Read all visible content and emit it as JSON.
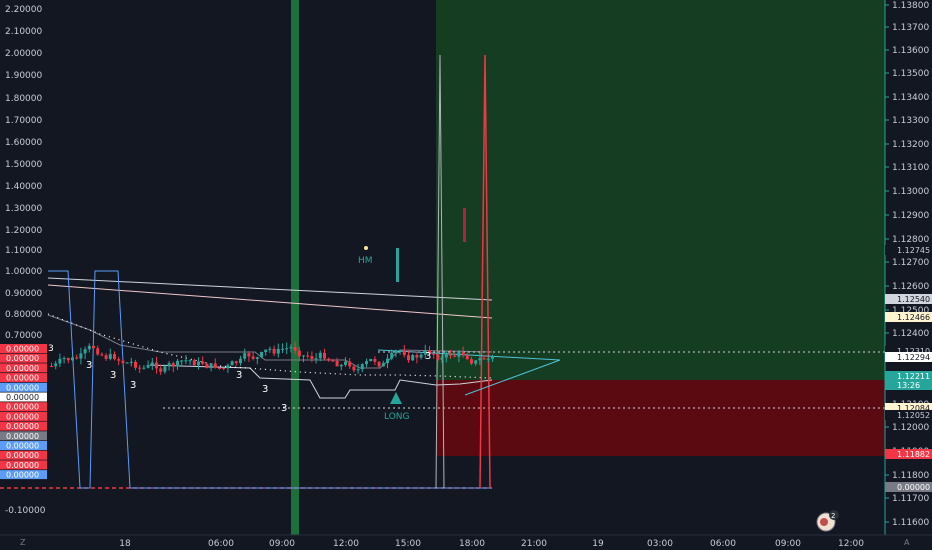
{
  "left_axis": {
    "ticks": [
      "2.20000",
      "2.10000",
      "2.00000",
      "1.90000",
      "1.80000",
      "1.70000",
      "1.60000",
      "1.50000",
      "1.40000",
      "1.30000",
      "1.20000",
      "1.10000",
      "1.00000",
      "0.90000",
      "0.80000",
      "0.70000",
      "0.00000",
      "-0.10000"
    ],
    "badges": [
      {
        "label": "0.00000",
        "color": "#f23645"
      },
      {
        "label": "0.00000",
        "color": "#f23645"
      },
      {
        "label": "0.00000",
        "color": "#f23645"
      },
      {
        "label": "0.00000",
        "color": "#f23645"
      },
      {
        "label": "0.00000",
        "color": "#5b9cf6"
      },
      {
        "label": "0.00000",
        "color": "#ffffff"
      },
      {
        "label": "0.00000",
        "color": "#f23645"
      },
      {
        "label": "0.00000",
        "color": "#f23645"
      },
      {
        "label": "0.00000",
        "color": "#f23645"
      },
      {
        "label": "0.00000",
        "color": "#787b86"
      },
      {
        "label": "0.00000",
        "color": "#5b9cf6"
      },
      {
        "label": "0.00000",
        "color": "#f23645"
      },
      {
        "label": "0.00000",
        "color": "#f23645"
      },
      {
        "label": "0.00000",
        "color": "#5b9cf6"
      }
    ],
    "badge_overflow": "3"
  },
  "right_axis": {
    "ticks": [
      "1.13800",
      "1.13700",
      "1.13600",
      "1.13500",
      "1.13400",
      "1.13300",
      "1.13200",
      "1.13100",
      "1.13000",
      "1.12900",
      "1.12800",
      "1.12700",
      "1.12600",
      "1.12500",
      "1.12400",
      "1.12300",
      "1.12100",
      "1.12000",
      "1.11900",
      "1.11800",
      "1.11700",
      "1.11600"
    ],
    "labels": [
      {
        "text": "1.12745",
        "bg": "#131722",
        "fg": "#c9ccd4"
      },
      {
        "text": "1.12540",
        "bg": "#d1d4dc",
        "fg": "#131722"
      },
      {
        "text": "1.12466",
        "bg": "#fff3d0",
        "fg": "#131722"
      },
      {
        "text": "1.12310",
        "bg": "#131722",
        "fg": "#c9ccd4"
      },
      {
        "text": "1.12294",
        "bg": "#ffffff",
        "fg": "#131722"
      },
      {
        "text": "1.12211",
        "bg": "#26a69a",
        "fg": "#ffffff"
      },
      {
        "text": "13:26",
        "bg": "#26a69a",
        "fg": "#ffffff"
      },
      {
        "text": "1.12084",
        "bg": "#fff3d0",
        "fg": "#131722"
      },
      {
        "text": "1.12052",
        "bg": "#131722",
        "fg": "#c9ccd4"
      },
      {
        "text": "1.11882",
        "bg": "#f23645",
        "fg": "#ffffff"
      },
      {
        "text": "0.00000",
        "bg": "#787b86",
        "fg": "#ffffff"
      }
    ]
  },
  "time_axis": {
    "ticks": [
      "18",
      "06:00",
      "09:00",
      "12:00",
      "15:00",
      "18:00",
      "21:00",
      "19",
      "03:00",
      "06:00",
      "09:00",
      "12:00"
    ],
    "left_button": "Z",
    "right_button": "A"
  },
  "annotations": {
    "hm_label": "HM",
    "long_label": "LONG",
    "counts": [
      "3",
      "3",
      "3",
      "3",
      "3",
      "3",
      "3"
    ]
  },
  "alert_badge": {
    "count": "2"
  },
  "colors": {
    "background": "#131722",
    "bull": "#26a69a",
    "bear": "#f23645",
    "profit_zone": "#143d22",
    "loss_zone": "#5a0a10",
    "vertical_band": "#1e7a3e",
    "axis_line": "#26a69a"
  }
}
